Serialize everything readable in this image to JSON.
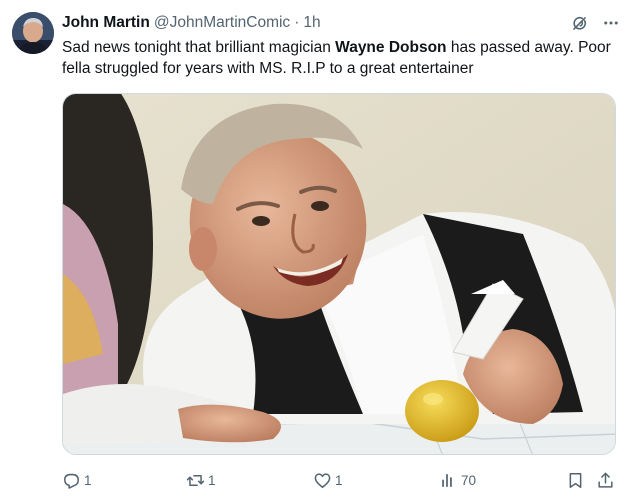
{
  "author": {
    "name": "John Martin",
    "handle": "@JohnMartinComic",
    "separator": "·",
    "time": "1h"
  },
  "tweet": {
    "text_before": "Sad news tonight that brilliant magician ",
    "text_bold": "Wayne Dobson",
    "text_after": " has passed away. Poor fella struggled for years with MS. R.I.P to a great entertainer"
  },
  "media": {
    "type": "photo"
  },
  "actions": {
    "replies": "1",
    "reposts": "1",
    "likes": "1",
    "views": "70"
  },
  "icons": {
    "header": [
      "grok-icon",
      "more-icon"
    ],
    "actions": [
      "reply-icon",
      "retweet-icon",
      "like-icon",
      "views-icon",
      "bookmark-icon",
      "share-icon"
    ]
  },
  "colors": {
    "text": "#0f1419",
    "secondary": "#536471",
    "border": "#cfd9de"
  }
}
